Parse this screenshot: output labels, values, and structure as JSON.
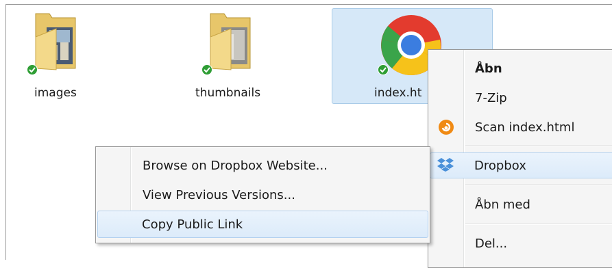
{
  "files": [
    {
      "name": "images",
      "type": "folder"
    },
    {
      "name": "thumbnails",
      "type": "folder"
    },
    {
      "name": "index.ht",
      "type": "chrome-html"
    }
  ],
  "main_menu": {
    "items": [
      {
        "label": "Åbn",
        "bold": true
      },
      {
        "label": "7-Zip"
      },
      {
        "label": "Scan index.html",
        "icon": "avast-scan-icon"
      },
      {
        "label": "Dropbox",
        "icon": "dropbox-icon",
        "highlighted": true
      },
      {
        "label": "Åbn med"
      },
      {
        "label": "Del..."
      }
    ]
  },
  "dropbox_submenu": {
    "items": [
      {
        "label": "Browse on Dropbox Website..."
      },
      {
        "label": "View Previous Versions..."
      },
      {
        "label": "Copy Public Link",
        "highlighted": true
      }
    ]
  },
  "colors": {
    "selection": "#d6e8f8",
    "sync_check": "#2f9e35",
    "menu_bg": "#f5f5f5"
  }
}
